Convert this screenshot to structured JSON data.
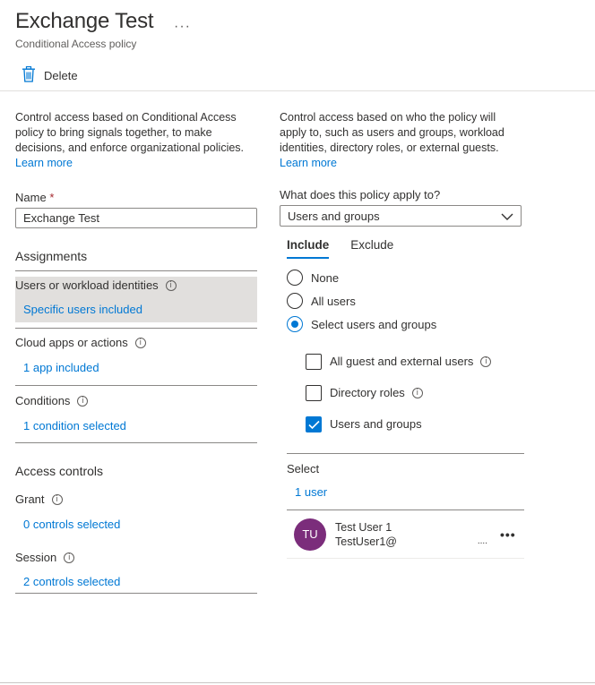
{
  "header": {
    "title": "Exchange Test",
    "more": "···",
    "subtitle": "Conditional Access policy"
  },
  "toolbar": {
    "delete_label": "Delete",
    "delete_icon": "trash-icon"
  },
  "left": {
    "description": "Control access based on Conditional Access policy to bring signals together, to make decisions, and enforce organizational policies.",
    "learn_more": "Learn more",
    "name_label": "Name",
    "required_mark": "*",
    "name_value": "Exchange Test",
    "assignments_heading": "Assignments",
    "rows": [
      {
        "title": "Users or workload identities",
        "value": "Specific users included"
      },
      {
        "title": "Cloud apps or actions",
        "value": "1 app included"
      },
      {
        "title": "Conditions",
        "value": "1 condition selected"
      }
    ],
    "access_heading": "Access controls",
    "access_rows": [
      {
        "title": "Grant",
        "value": "0 controls selected"
      },
      {
        "title": "Session",
        "value": "2 controls selected"
      }
    ],
    "info_icon": "info-icon"
  },
  "right": {
    "description": "Control access based on who the policy will apply to, such as users and groups, workload identities, directory roles, or external guests.",
    "learn_more": "Learn more",
    "apply_label": "What does this policy apply to?",
    "apply_value": "Users and groups",
    "tabs": [
      {
        "label": "Include",
        "active": true
      },
      {
        "label": "Exclude",
        "active": false
      }
    ],
    "radios": [
      {
        "label": "None",
        "checked": false
      },
      {
        "label": "All users",
        "checked": false
      },
      {
        "label": "Select users and groups",
        "checked": true
      }
    ],
    "checks": [
      {
        "label": "All guest and external users",
        "checked": false
      },
      {
        "label": "Directory roles",
        "checked": false
      },
      {
        "label": "Users and groups",
        "checked": true
      }
    ],
    "select_label": "Select",
    "select_count": "1 user",
    "user": {
      "initials": "TU",
      "name": "Test User 1",
      "email": "TestUser1@",
      "email_tail": "....",
      "more": "•••",
      "avatar_color": "#7b2d7b"
    }
  },
  "colors": {
    "accent": "#0078d4",
    "required": "#a4262c",
    "selected_bg": "#e1dfdd"
  }
}
